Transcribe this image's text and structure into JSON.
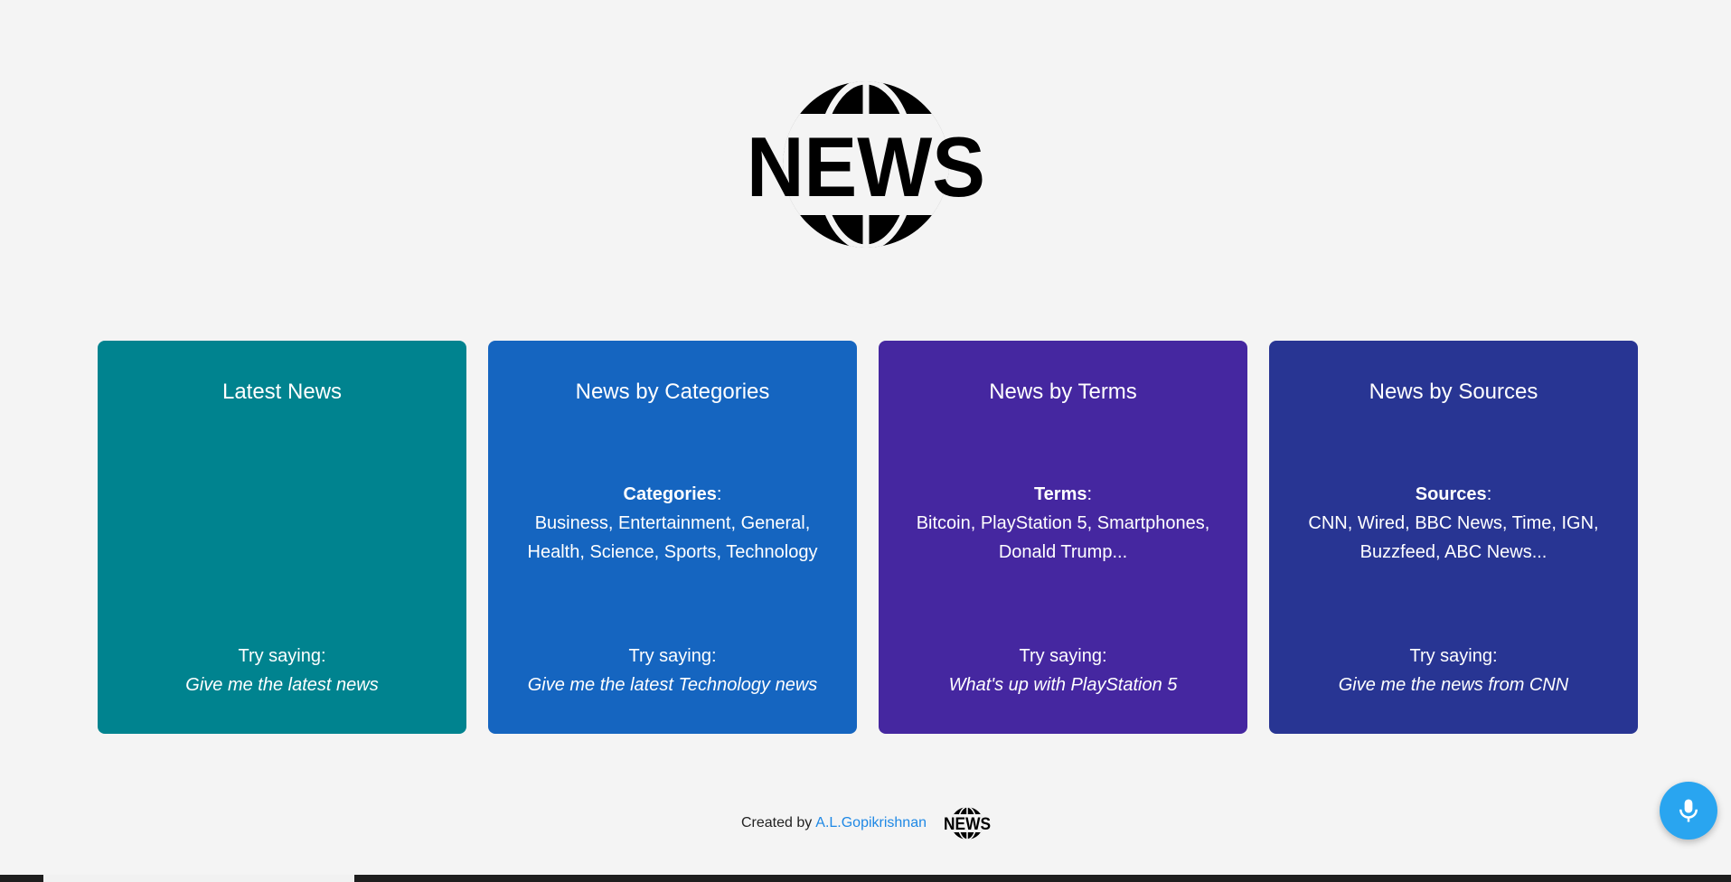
{
  "header": {
    "logo_text": "NEWS",
    "logo_icon": "globe-news-logo"
  },
  "cards": [
    {
      "title": "Latest News",
      "info_label": "",
      "info_colon": "",
      "info_text": "",
      "try_label": "Try saying:",
      "example": "Give me the latest news",
      "color": "#00838f"
    },
    {
      "title": "News by Categories",
      "info_label": "Categories",
      "info_colon": ":",
      "info_text": "Business, Entertainment, General, Health, Science, Sports, Technology",
      "try_label": "Try saying:",
      "example": "Give me the latest Technology news",
      "color": "#1565c0"
    },
    {
      "title": "News by Terms",
      "info_label": "Terms",
      "info_colon": ":",
      "info_text": "Bitcoin, PlayStation 5, Smartphones, Donald Trump...",
      "try_label": "Try saying:",
      "example": "What's up with PlayStation 5",
      "color": "#4527a0"
    },
    {
      "title": "News by Sources",
      "info_label": "Sources",
      "info_colon": ":",
      "info_text": "CNN, Wired, BBC News, Time, IGN, Buzzfeed, ABC News...",
      "try_label": "Try saying:",
      "example": "Give me the news from CNN",
      "color": "#283593"
    }
  ],
  "footer": {
    "created_by": "Created by",
    "author": "A.L.Gopikrishnan",
    "mini_logo_text": "NEWS"
  },
  "mic_button": {
    "icon": "microphone-icon",
    "color": "#29a5f0"
  }
}
